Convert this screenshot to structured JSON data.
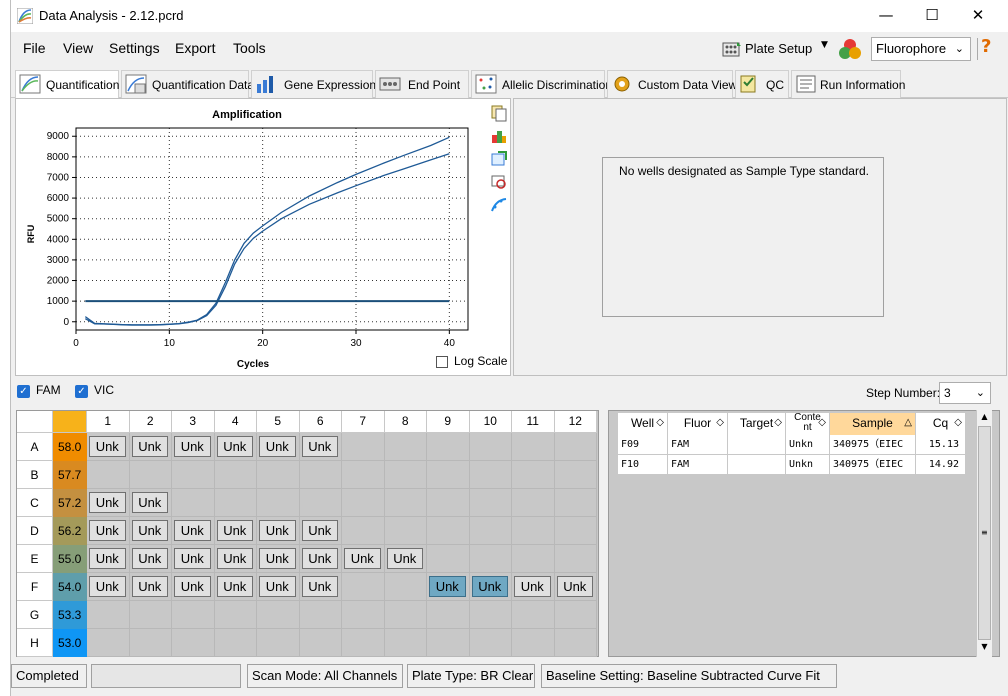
{
  "window": {
    "title": "Data Analysis - 2.12.pcrd"
  },
  "menu": [
    "File",
    "View",
    "Settings",
    "Export",
    "Tools"
  ],
  "toolbar": {
    "plate_setup": "Plate Setup",
    "fluorophore_select": "Fluorophore"
  },
  "tabs": [
    "Quantification",
    "Quantification Data",
    "Gene Expression",
    "End Point",
    "Allelic Discrimination",
    "Custom Data View",
    "QC",
    "Run Information"
  ],
  "standard_panel": {
    "message": "No wells designated as Sample Type standard."
  },
  "chart_data": {
    "type": "line",
    "title": "Amplification",
    "xlabel": "Cycles",
    "ylabel": "RFU",
    "xlim": [
      0,
      42
    ],
    "ylim": [
      -400,
      9400
    ],
    "x_ticks": [
      0,
      10,
      20,
      30,
      40
    ],
    "y_ticks": [
      0,
      1000,
      2000,
      3000,
      4000,
      5000,
      6000,
      7000,
      8000,
      9000
    ],
    "grid": true,
    "threshold": 1000,
    "series": [
      {
        "x": [
          1,
          2,
          3,
          4,
          5,
          6,
          7,
          8,
          9,
          10,
          11,
          12,
          13,
          14,
          15,
          16,
          17,
          18,
          19,
          20,
          22,
          25,
          28,
          30,
          33,
          35,
          38,
          40
        ],
        "y": [
          250,
          -80,
          -100,
          -120,
          -140,
          -150,
          -150,
          -150,
          -140,
          -120,
          -90,
          -20,
          80,
          350,
          900,
          1900,
          3000,
          3800,
          4300,
          4650,
          5300,
          6100,
          6750,
          7150,
          7700,
          8050,
          8550,
          8950
        ]
      },
      {
        "x": [
          1,
          2,
          3,
          4,
          5,
          6,
          7,
          8,
          9,
          10,
          11,
          12,
          13,
          14,
          15,
          16,
          17,
          18,
          19,
          20,
          22,
          25,
          28,
          30,
          33,
          35,
          38,
          40
        ],
        "y": [
          150,
          -100,
          -110,
          -130,
          -150,
          -160,
          -160,
          -160,
          -150,
          -130,
          -100,
          -40,
          60,
          300,
          800,
          1700,
          2800,
          3550,
          4050,
          4400,
          5000,
          5700,
          6250,
          6600,
          7100,
          7400,
          7850,
          8150
        ]
      }
    ]
  },
  "chart_options": {
    "log_scale": "Log Scale"
  },
  "filters": {
    "fam": "FAM",
    "vic": "VIC",
    "step_label": "Step Number:",
    "step_value": "3"
  },
  "plate": {
    "columns": [
      "1",
      "2",
      "3",
      "4",
      "5",
      "6",
      "7",
      "8",
      "9",
      "10",
      "11",
      "12"
    ],
    "rows": [
      {
        "label": "A",
        "temp": "58.0",
        "wells": [
          "Unk",
          "Unk",
          "Unk",
          "Unk",
          "Unk",
          "Unk",
          "",
          "",
          "",
          "",
          "",
          ""
        ]
      },
      {
        "label": "B",
        "temp": "57.7",
        "wells": [
          "",
          "",
          "",
          "",
          "",
          "",
          "",
          "",
          "",
          "",
          "",
          ""
        ]
      },
      {
        "label": "C",
        "temp": "57.2",
        "wells": [
          "Unk",
          "Unk",
          "",
          "",
          "",
          "",
          "",
          "",
          "",
          "",
          "",
          ""
        ]
      },
      {
        "label": "D",
        "temp": "56.2",
        "wells": [
          "Unk",
          "Unk",
          "Unk",
          "Unk",
          "Unk",
          "Unk",
          "",
          "",
          "",
          "",
          "",
          ""
        ]
      },
      {
        "label": "E",
        "temp": "55.0",
        "wells": [
          "Unk",
          "Unk",
          "Unk",
          "Unk",
          "Unk",
          "Unk",
          "Unk",
          "Unk",
          "",
          "",
          "",
          ""
        ]
      },
      {
        "label": "F",
        "temp": "54.0",
        "wells": [
          "Unk",
          "Unk",
          "Unk",
          "Unk",
          "Unk",
          "Unk",
          "",
          "",
          "Unk",
          "Unk",
          "Unk",
          "Unk"
        ]
      },
      {
        "label": "G",
        "temp": "53.3",
        "wells": [
          "",
          "",
          "",
          "",
          "",
          "",
          "",
          "",
          "",
          "",
          "",
          ""
        ]
      },
      {
        "label": "H",
        "temp": "53.0",
        "wells": [
          "",
          "",
          "",
          "",
          "",
          "",
          "",
          "",
          "",
          "",
          "",
          ""
        ]
      }
    ],
    "selected_wells": [
      "F9",
      "F10"
    ],
    "gradient_colors": [
      "#f08c00",
      "#d98a20",
      "#c49040",
      "#a49a5a",
      "#869e78",
      "#5f9eab",
      "#2f9ad8",
      "#0f96f5"
    ]
  },
  "results_table": {
    "headers": [
      "Well",
      "Fluor",
      "Target",
      "Content",
      "Sample",
      "Cq"
    ],
    "rows": [
      [
        "F09",
        "FAM",
        "",
        "Unkn",
        "340975（EIEC",
        "15.13"
      ],
      [
        "F10",
        "FAM",
        "",
        "Unkn",
        "340975（EIEC",
        "14.92"
      ]
    ]
  },
  "status": {
    "state": "Completed",
    "scan_mode": "Scan Mode: All Channels",
    "plate_type": "Plate Type: BR Clear",
    "baseline": "Baseline Setting: Baseline Subtracted Curve Fit"
  }
}
